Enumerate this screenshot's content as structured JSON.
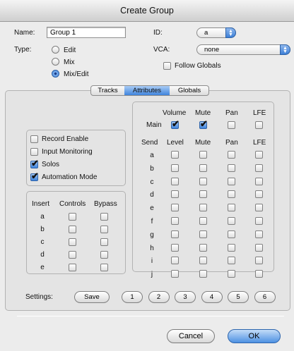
{
  "window": {
    "title": "Create Group"
  },
  "name": {
    "label": "Name:",
    "value": "Group 1"
  },
  "id": {
    "label": "ID:",
    "value": "a"
  },
  "type": {
    "label": "Type:",
    "options": [
      "Edit",
      "Mix",
      "Mix/Edit"
    ],
    "selected": "Mix/Edit"
  },
  "vca": {
    "label": "VCA:",
    "value": "none"
  },
  "follow_globals": {
    "label": "Follow Globals",
    "checked": false
  },
  "tabs": {
    "items": [
      "Tracks",
      "Attributes",
      "Globals"
    ],
    "active": "Attributes"
  },
  "attributes": [
    {
      "label": "Record Enable",
      "checked": false
    },
    {
      "label": "Input Monitoring",
      "checked": false
    },
    {
      "label": "Solos",
      "checked": true
    },
    {
      "label": "Automation Mode",
      "checked": true
    }
  ],
  "insert": {
    "headers": [
      "Insert",
      "Controls",
      "Bypass"
    ],
    "rows": [
      {
        "label": "a",
        "controls": false,
        "bypass": false
      },
      {
        "label": "b",
        "controls": false,
        "bypass": false
      },
      {
        "label": "c",
        "controls": false,
        "bypass": false
      },
      {
        "label": "d",
        "controls": false,
        "bypass": false
      },
      {
        "label": "e",
        "controls": false,
        "bypass": false
      }
    ]
  },
  "main": {
    "headers": [
      "Volume",
      "Mute",
      "Pan",
      "LFE"
    ],
    "row_label": "Main",
    "values": [
      true,
      true,
      false,
      false
    ]
  },
  "send": {
    "headers": [
      "Send",
      "Level",
      "Mute",
      "Pan",
      "LFE"
    ],
    "rows": [
      {
        "label": "a",
        "values": [
          false,
          false,
          false,
          false
        ]
      },
      {
        "label": "b",
        "values": [
          false,
          false,
          false,
          false
        ]
      },
      {
        "label": "c",
        "values": [
          false,
          false,
          false,
          false
        ]
      },
      {
        "label": "d",
        "values": [
          false,
          false,
          false,
          false
        ]
      },
      {
        "label": "e",
        "values": [
          false,
          false,
          false,
          false
        ]
      },
      {
        "label": "f",
        "values": [
          false,
          false,
          false,
          false
        ]
      },
      {
        "label": "g",
        "values": [
          false,
          false,
          false,
          false
        ]
      },
      {
        "label": "h",
        "values": [
          false,
          false,
          false,
          false
        ]
      },
      {
        "label": "i",
        "values": [
          false,
          false,
          false,
          false
        ]
      },
      {
        "label": "j",
        "values": [
          false,
          false,
          false,
          false
        ]
      }
    ]
  },
  "settings": {
    "label": "Settings:",
    "save_label": "Save",
    "slots": [
      "1",
      "2",
      "3",
      "4",
      "5",
      "6"
    ]
  },
  "buttons": {
    "cancel": "Cancel",
    "ok": "OK"
  }
}
